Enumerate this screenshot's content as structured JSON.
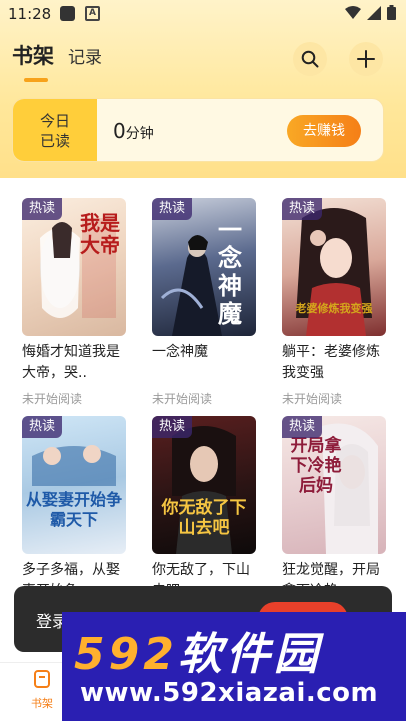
{
  "status_bar": {
    "time": "11:28",
    "notif_letter": "A"
  },
  "header": {
    "tab_shelf": "书架",
    "tab_history": "记录"
  },
  "reading": {
    "today_line1": "今日",
    "today_line2": "已读",
    "minutes_value": "0",
    "minutes_unit": "分钟",
    "earn_label": "去赚钱"
  },
  "books": [
    {
      "badge": "热读",
      "title": "悔婚才知道我是大帝，哭..",
      "status": "未开始阅读",
      "cover_text": "我是大帝"
    },
    {
      "badge": "热读",
      "title": "一念神魔",
      "status": "未开始阅读",
      "cover_text": "一念神魔"
    },
    {
      "badge": "热读",
      "title": "躺平：老婆修炼我变强",
      "status": "未开始阅读",
      "cover_text": "老婆修炼我变强"
    },
    {
      "badge": "热读",
      "title": "多子多福，从娶妻开始争",
      "status": "",
      "cover_text": "从娶妻开始争霸天下"
    },
    {
      "badge": "热读",
      "title": "你无敌了，下山去吧",
      "status": "",
      "cover_text": "你无敌了下山去吧"
    },
    {
      "badge": "热读",
      "title": "狂龙觉醒，开局拿下冷艳",
      "status": "",
      "cover_text": "开局拿下冷艳后妈"
    }
  ],
  "toast": {
    "text": "登录"
  },
  "bottom_nav": {
    "shelf_label": "书架"
  },
  "watermark": {
    "digits": "592",
    "name": "软件园",
    "url": "www.592xiazai.com"
  }
}
